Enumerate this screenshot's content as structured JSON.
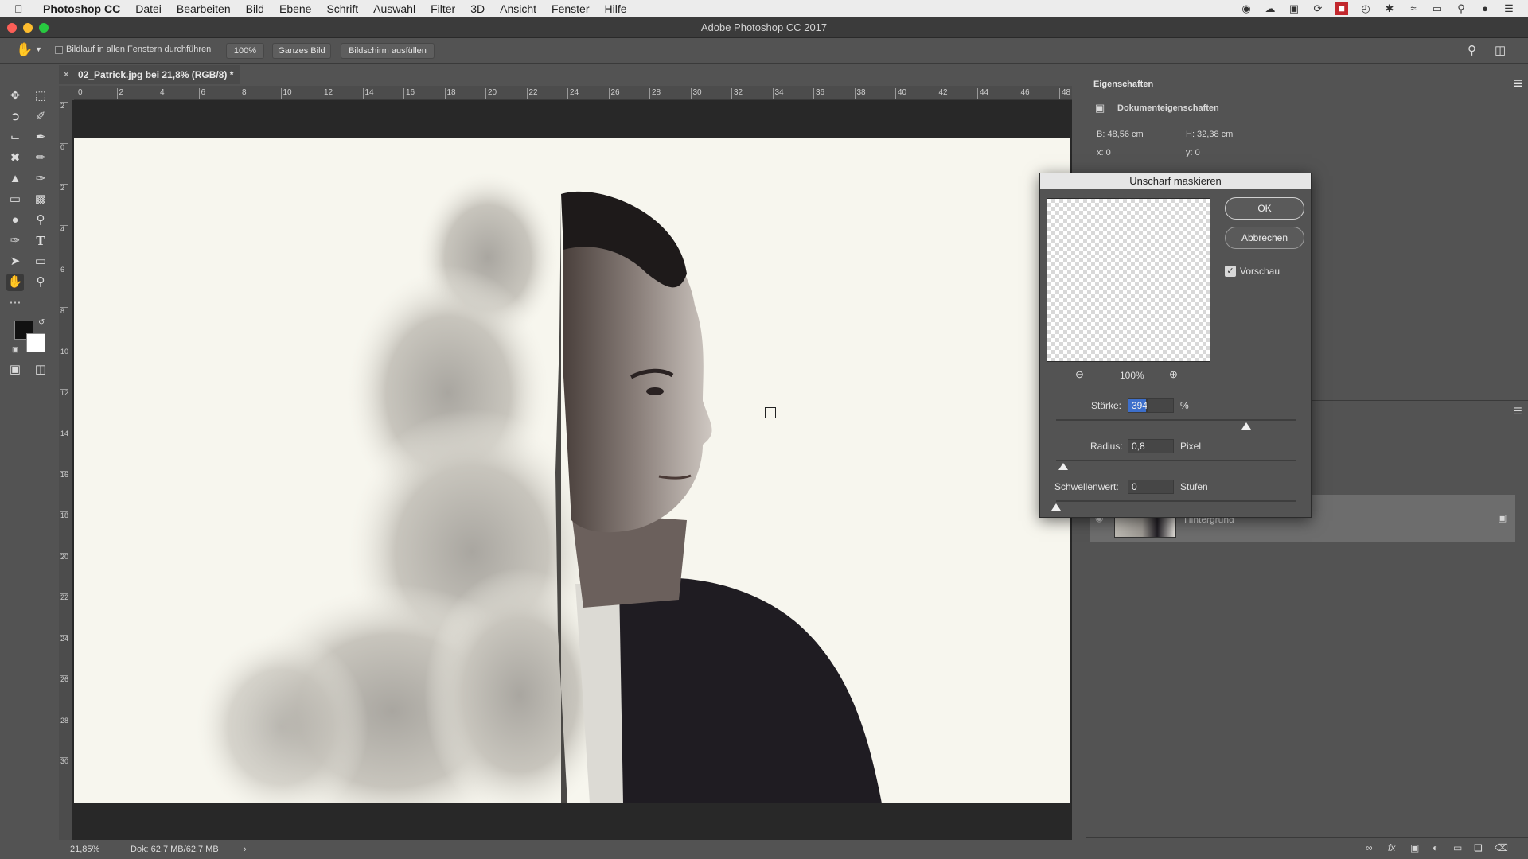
{
  "menubar": {
    "app_name": "Photoshop CC",
    "items": [
      "Datei",
      "Bearbeiten",
      "Bild",
      "Ebene",
      "Schrift",
      "Auswahl",
      "Filter",
      "3D",
      "Ansicht",
      "Fenster",
      "Hilfe"
    ]
  },
  "window": {
    "title": "Adobe Photoshop CC 2017"
  },
  "options_bar": {
    "scroll_all_label": "Bildlauf in allen Fenstern durchführen",
    "zoom_100": "100%",
    "fit_screen": "Ganzes Bild",
    "fill_screen": "Bildschirm ausfüllen"
  },
  "document": {
    "tab_title": "02_Patrick.jpg bei 21,8% (RGB/8) *",
    "ruler_h_ticks": [
      "0",
      "2",
      "4",
      "6",
      "8",
      "10",
      "12",
      "14",
      "16",
      "18",
      "20",
      "22",
      "24",
      "26",
      "28",
      "30",
      "32",
      "34",
      "36",
      "38",
      "40",
      "42",
      "44",
      "46",
      "48"
    ],
    "ruler_v_ticks": [
      "2",
      "0",
      "2",
      "4",
      "6",
      "8",
      "10",
      "12",
      "14",
      "16",
      "18",
      "20",
      "22",
      "24",
      "26",
      "28",
      "30"
    ]
  },
  "status_bar": {
    "zoom": "21,85%",
    "doc_size": "Dok: 62,7 MB/62,7 MB"
  },
  "properties": {
    "panel_title": "Eigenschaften",
    "section": "Dokumenteigenschaften",
    "width": "B:  48,56 cm",
    "height": "H:  32,38 cm",
    "x": "x:  0",
    "y": "y:  0"
  },
  "layers": {
    "layer_name": "Hintergrund"
  },
  "dialog": {
    "title": "Unscharf maskieren",
    "ok": "OK",
    "cancel": "Abbrechen",
    "preview_label": "Vorschau",
    "preview_checked": true,
    "preview_zoom": "100%",
    "amount_label": "Stärke:",
    "amount_value": "394",
    "amount_unit": "%",
    "amount_fraction": 0.79,
    "radius_label": "Radius:",
    "radius_value": "0,8",
    "radius_unit": "Pixel",
    "radius_fraction": 0.03,
    "threshold_label": "Schwellenwert:",
    "threshold_value": "0",
    "threshold_unit": "Stufen",
    "threshold_fraction": 0.0
  },
  "colors": {
    "foreground": "#111111",
    "background": "#ffffff",
    "photo_bg": "#f7f6ee"
  }
}
